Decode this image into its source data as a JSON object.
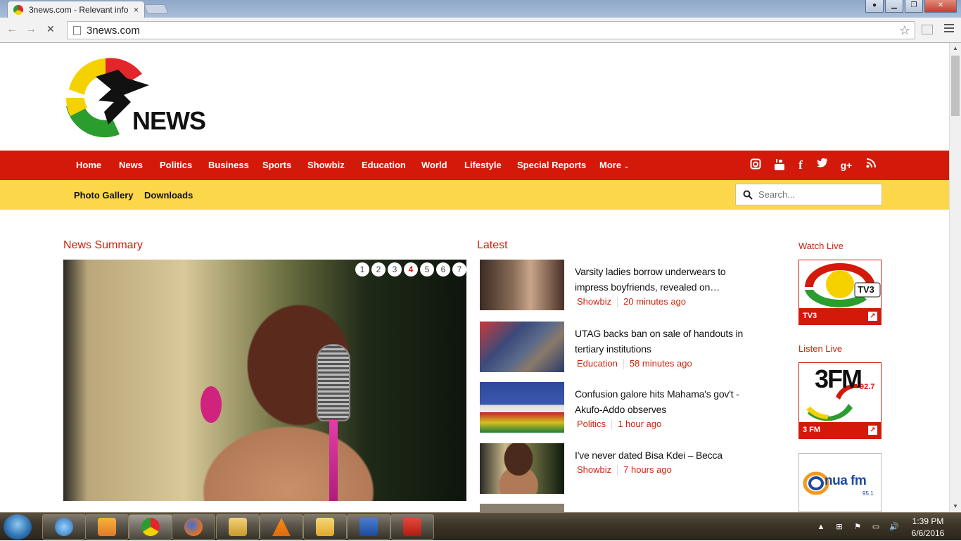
{
  "browser": {
    "tab_title": "3news.com - Relevant info",
    "tab_close": "×",
    "url": "3news.com"
  },
  "site": {
    "logo_text": "NEWS",
    "nav": [
      "Home",
      "News",
      "Politics",
      "Business",
      "Sports",
      "Showbiz",
      "Education",
      "World",
      "Lifestyle",
      "Special Reports",
      "More"
    ],
    "social_icons": [
      "instagram-icon",
      "youtube-icon",
      "facebook-icon",
      "twitter-icon",
      "google-plus-icon",
      "rss-icon"
    ],
    "subnav": [
      "Photo Gallery",
      "Downloads"
    ],
    "search_placeholder": "Search..."
  },
  "sections": {
    "news_summary": "News Summary",
    "latest": "Latest",
    "watch_live": "Watch Live",
    "listen_live": "Listen Live"
  },
  "slider": {
    "pages": [
      "1",
      "2",
      "3",
      "4",
      "5",
      "6",
      "7"
    ],
    "active_page": "4"
  },
  "latest": [
    {
      "title": "Varsity ladies borrow underwears to impress boyfriends, revealed on…",
      "category": "Showbiz",
      "time": "20 minutes ago"
    },
    {
      "title": "UTAG backs ban on sale of handouts in tertiary institutions",
      "category": "Education",
      "time": "58 minutes ago"
    },
    {
      "title": "Confusion galore hits Mahama's gov't - Akufo-Addo observes",
      "category": "Politics",
      "time": "1 hour ago"
    },
    {
      "title": "I've never dated Bisa Kdei – Becca",
      "category": "Showbiz",
      "time": "7 hours ago"
    }
  ],
  "live": {
    "tv3_logo_text": "TV3",
    "tv3_label": "TV3",
    "fm3_logo_text": "3FM",
    "fm3_freq": "92.7",
    "fm3_label": "3 FM",
    "nua_logo_text": "nua fm",
    "nua_freq": "95.1"
  },
  "taskbar": {
    "time": "1:39 PM",
    "date": "6/6/2016"
  },
  "colors": {
    "brand_red": "#d31a0a",
    "brand_yellow": "#fcd74a",
    "accent_text": "#c9260e"
  }
}
